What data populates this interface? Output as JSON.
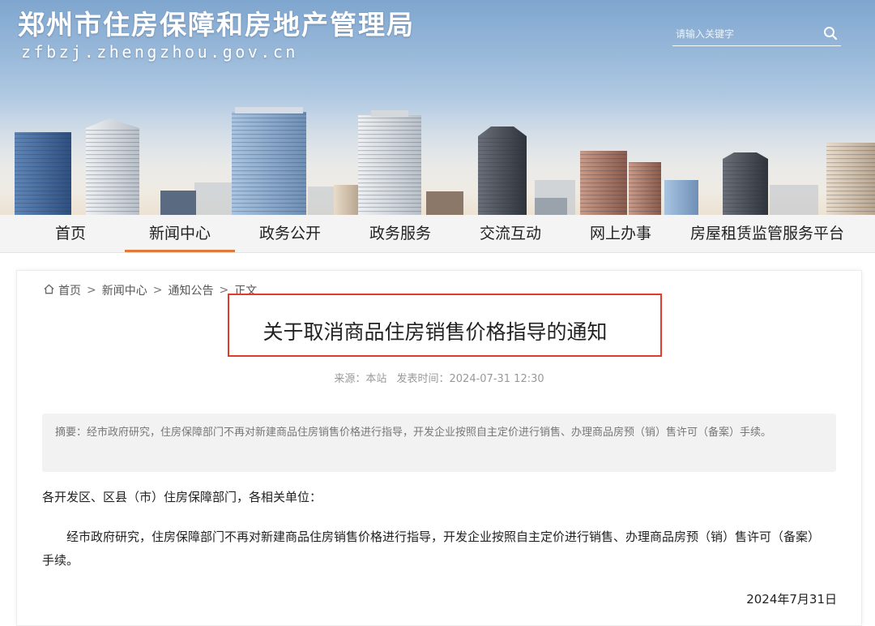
{
  "header": {
    "site_title": "郑州市住房保障和房地产管理局",
    "site_domain": "zfbzj.zhengzhou.gov.cn",
    "search_placeholder": "请输入关键字",
    "search_icon": "search-icon"
  },
  "nav": {
    "items": [
      {
        "label": "首页",
        "active": false
      },
      {
        "label": "新闻中心",
        "active": true
      },
      {
        "label": "政务公开",
        "active": false
      },
      {
        "label": "政务服务",
        "active": false
      },
      {
        "label": "交流互动",
        "active": false
      },
      {
        "label": "网上办事",
        "active": false
      },
      {
        "label": "房屋租赁监管服务平台",
        "active": false
      }
    ],
    "active_color": "#e07b39"
  },
  "breadcrumb": {
    "home_icon": "home-icon",
    "items": [
      "首页",
      "新闻中心",
      "通知公告",
      "正文"
    ],
    "separator": ">"
  },
  "article": {
    "title": "关于取消商品住房销售价格指导的通知",
    "highlight_color": "#e23a2b",
    "source": "来源：本站",
    "publish_time": "发表时间：2024-07-31 12:30",
    "abstract": "摘要：经市政府研究，住房保障部门不再对新建商品住房销售价格进行指导，开发企业按照自主定价进行销售、办理商品房预（销）售许可（备案）手续。",
    "salutation": "各开发区、区县（市）住房保障部门，各相关单位：",
    "body": "经市政府研究，住房保障部门不再对新建商品住房销售价格进行指导，开发企业按照自主定价进行销售、办理商品房预（销）售许可（备案）手续。",
    "sign_date": "2024年7月31日"
  }
}
